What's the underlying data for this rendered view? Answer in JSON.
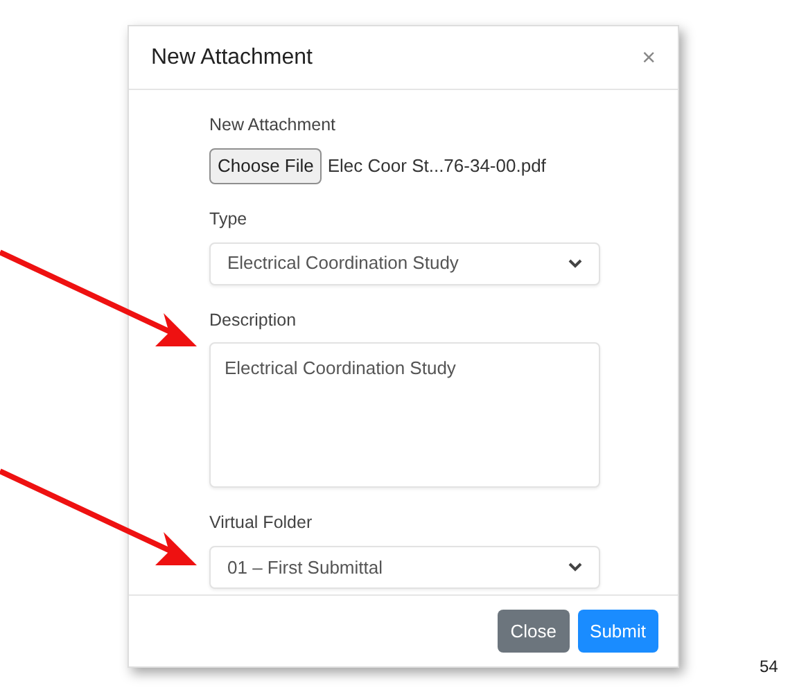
{
  "dialog": {
    "title": "New Attachment",
    "close_glyph": "×",
    "fields": [
      {
        "kind": "file",
        "label": "New Attachment",
        "button": "Choose File",
        "value": "Elec Coor St...76-34-00.pdf"
      },
      {
        "kind": "select",
        "label": "Type",
        "value": "Electrical Coordination Study"
      },
      {
        "kind": "textarea",
        "label": "Description",
        "value": "Electrical Coordination Study"
      },
      {
        "kind": "select",
        "label": "Virtual Folder",
        "value": "01 – First Submittal"
      }
    ],
    "buttons": [
      {
        "label": "Close",
        "kind": "secondary"
      },
      {
        "label": "Submit",
        "kind": "primary"
      }
    ]
  },
  "page_number": "54"
}
